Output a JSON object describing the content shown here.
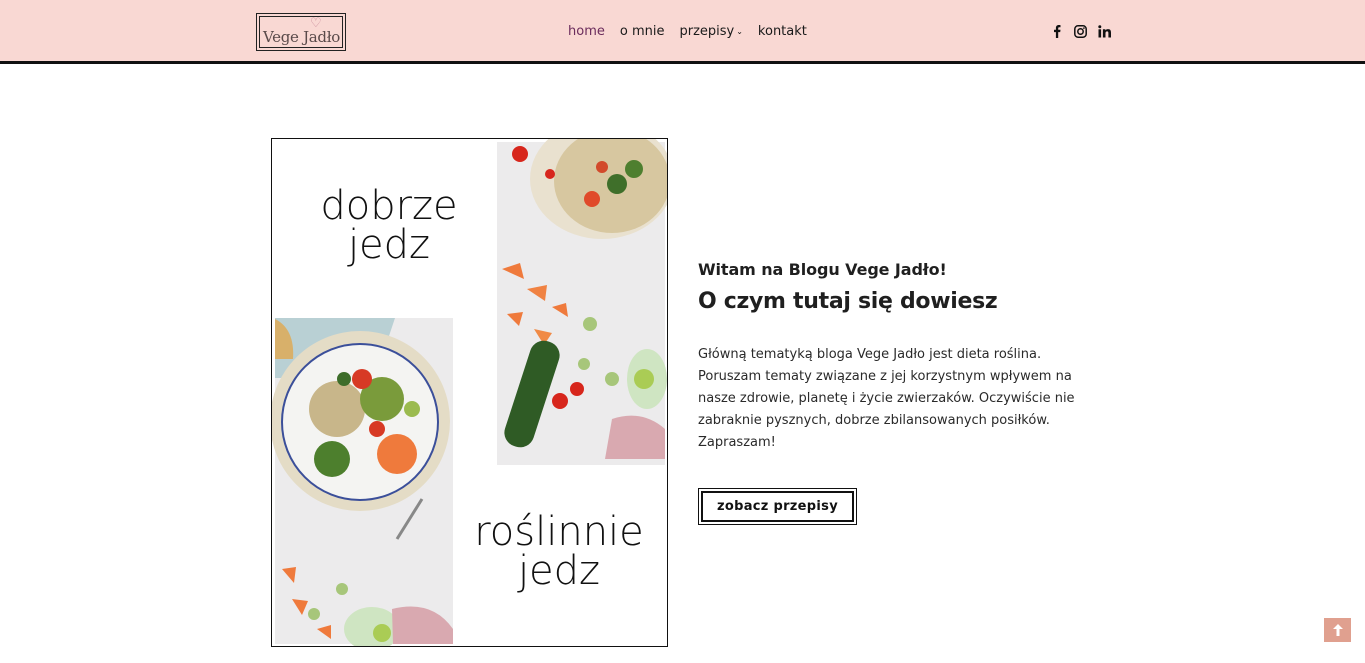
{
  "header": {
    "logo_text": "Vege Jadło",
    "nav": [
      {
        "label": "home",
        "active": true
      },
      {
        "label": "o mnie",
        "active": false
      },
      {
        "label": "przepisy",
        "active": false,
        "has_dropdown": true
      },
      {
        "label": "kontakt",
        "active": false
      }
    ],
    "social": [
      "facebook-icon",
      "instagram-icon",
      "linkedin-icon"
    ]
  },
  "hero": {
    "top_words": "dobrze jedz",
    "bottom_words": "roślinnie jedz"
  },
  "intro": {
    "subtitle": "Witam na Blogu Vege Jadło!",
    "title": "O czym tutaj się dowiesz",
    "body": "Główną tematyką bloga Vege Jadło jest dieta roślina. Poruszam tematy związane z jej korzystnym wpływem na nasze zdrowie, planetę i życie zwierzaków. Oczywiście nie zabraknie pysznych, dobrze zbilansowanych posiłków. Zapraszam!",
    "cta_label": "zobacz przepisy"
  },
  "colors": {
    "header_bg": "#f9d8d3",
    "active_nav": "#6b2c5c",
    "scroll_top_bg": "#e0a08f"
  }
}
